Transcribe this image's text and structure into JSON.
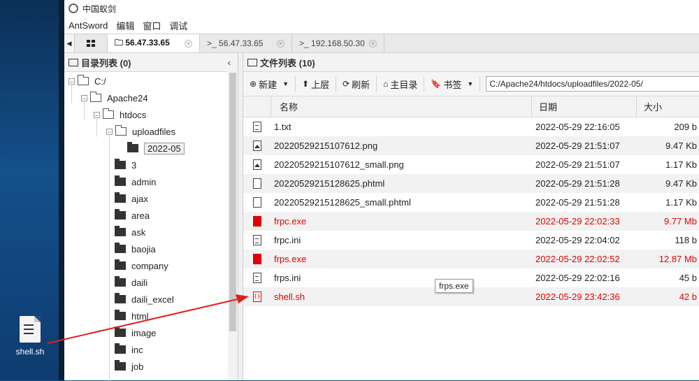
{
  "app": {
    "title": "中国蚁剑",
    "menu": [
      "AntSword",
      "编辑",
      "窗口",
      "调试"
    ]
  },
  "tabs": [
    {
      "label": "56.47.33.65",
      "prefix": "🗀",
      "active": true
    },
    {
      "label": "56.47.33.65",
      "prefix": ">_",
      "active": false
    },
    {
      "label": "192.168.50.30",
      "prefix": ">_",
      "active": false
    }
  ],
  "dir_panel": {
    "title": "目录列表 (0)",
    "collapse_icon": "‹"
  },
  "tree": {
    "root": "C:/",
    "apache": "Apache24",
    "htdocs": "htdocs",
    "uploadfiles": "uploadfiles",
    "selected": "2022-05",
    "folders": [
      "3",
      "admin",
      "ajax",
      "area",
      "ask",
      "baojia",
      "company",
      "daili",
      "daili_excel",
      "html",
      "image",
      "inc",
      "job"
    ]
  },
  "file_panel": {
    "title": "文件列表 (10)",
    "toolbar": {
      "new": "新建",
      "up": "上层",
      "refresh": "刷新",
      "home": "主目录",
      "bookmark": "书签"
    },
    "path": "C:/Apache24/htdocs/uploadfiles/2022-05/",
    "columns": {
      "name": "名称",
      "date": "日期",
      "size": "大小"
    },
    "files": [
      {
        "name": "1.txt",
        "date": "2022-05-29 22:16:05",
        "size": "209 b",
        "icon": "text-file-icon",
        "highlight": false
      },
      {
        "name": "20220529215107612.png",
        "date": "2022-05-29 21:51:07",
        "size": "9.47 Kb",
        "icon": "image-file-icon",
        "highlight": false
      },
      {
        "name": "20220529215107612_small.png",
        "date": "2022-05-29 21:51:07",
        "size": "1.17 Kb",
        "icon": "image-file-icon",
        "highlight": false
      },
      {
        "name": "20220529215128625.phtml",
        "date": "2022-05-29 21:51:28",
        "size": "9.47 Kb",
        "icon": "blank-file-icon",
        "highlight": false
      },
      {
        "name": "20220529215128625_small.phtml",
        "date": "2022-05-29 21:51:28",
        "size": "1.17 Kb",
        "icon": "blank-file-icon",
        "highlight": false
      },
      {
        "name": "frpc.exe",
        "date": "2022-05-29 22:02:33",
        "size": "9.77 Mb",
        "icon": "exe-file-icon",
        "highlight": true
      },
      {
        "name": "frpc.ini",
        "date": "2022-05-29 22:04:02",
        "size": "118 b",
        "icon": "text-file-icon",
        "highlight": false
      },
      {
        "name": "frps.exe",
        "date": "2022-05-29 22:02:52",
        "size": "12.87 Mb",
        "icon": "exe-file-icon",
        "highlight": true
      },
      {
        "name": "frps.ini",
        "date": "2022-05-29 22:02:16",
        "size": "45 b",
        "icon": "text-file-icon",
        "highlight": false
      },
      {
        "name": "shell.sh",
        "date": "2022-05-29 23:42:36",
        "size": "42 b",
        "icon": "script-file-icon",
        "highlight": true
      }
    ]
  },
  "tooltip": "frps.exe",
  "desktop": {
    "icon_label": "shell.sh"
  },
  "colors": {
    "highlight": "#e00000",
    "annotation_arrow": "#e02020"
  }
}
